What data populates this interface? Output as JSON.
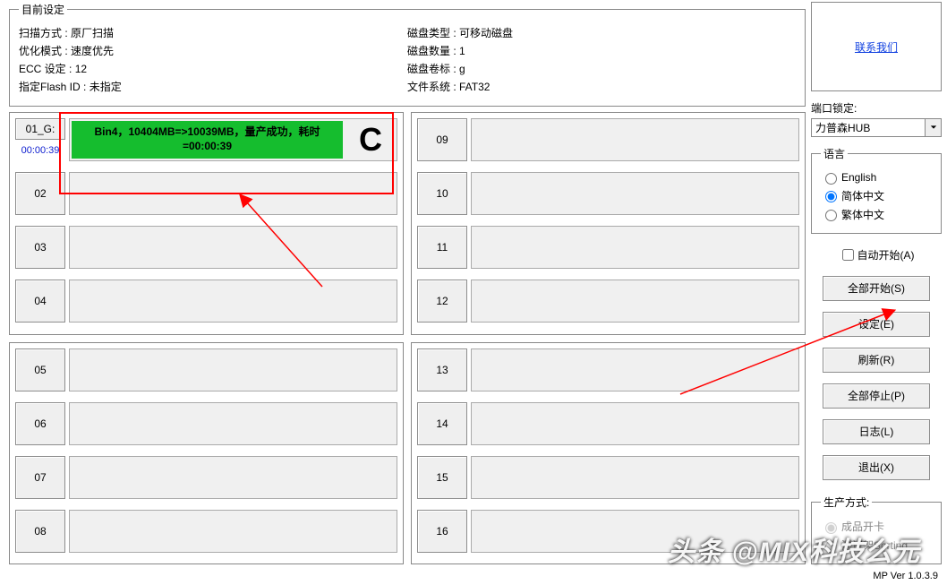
{
  "settings": {
    "legend": "目前设定",
    "left": {
      "scan_mode_label": "扫描方式 : ",
      "scan_mode_value": "原厂扫描",
      "optimize_mode_label": "优化模式 : ",
      "optimize_mode_value": "速度优先",
      "ecc_label": "ECC 设定 : ",
      "ecc_value": "12",
      "flash_id_label": "指定Flash ID : ",
      "flash_id_value": "未指定"
    },
    "right": {
      "disk_type_label": "磁盘类型 : ",
      "disk_type_value": "可移动磁盘",
      "disk_count_label": "磁盘数量 : ",
      "disk_count_value": "1",
      "disk_volume_label": "磁盘卷标 : ",
      "disk_volume_value": "g",
      "filesystem_label": "文件系统 : ",
      "filesystem_value": "FAT32"
    }
  },
  "panels": [
    {
      "slots": [
        {
          "id": "01_G:",
          "time": "00:00:39",
          "success": true,
          "msg": "Bin4，10404MB=>10039MB，量产成功，耗时=00:00:39",
          "status_letter": "C"
        },
        {
          "id": "02"
        },
        {
          "id": "03"
        },
        {
          "id": "04"
        }
      ]
    },
    {
      "slots": [
        {
          "id": "09"
        },
        {
          "id": "10"
        },
        {
          "id": "11"
        },
        {
          "id": "12"
        }
      ]
    },
    {
      "slots": [
        {
          "id": "05"
        },
        {
          "id": "06"
        },
        {
          "id": "07"
        },
        {
          "id": "08"
        }
      ]
    },
    {
      "slots": [
        {
          "id": "13"
        },
        {
          "id": "14"
        },
        {
          "id": "15"
        },
        {
          "id": "16"
        }
      ]
    }
  ],
  "contact_link": "联系我们",
  "port_lock": {
    "label": "端口锁定:",
    "value": "力普森HUB"
  },
  "language": {
    "legend": "语言",
    "options": [
      "English",
      "简体中文",
      "繁体中文"
    ],
    "selected": "简体中文"
  },
  "auto_start": "自动开始(A)",
  "buttons": {
    "start_all": "全部开始(S)",
    "settings": "设定(E)",
    "refresh": "刷新(R)",
    "stop_all": "全部停止(P)",
    "log": "日志(L)",
    "exit": "退出(X)"
  },
  "production": {
    "legend": "生产方式:",
    "options": [
      "成品开卡",
      "测试架Sorting"
    ]
  },
  "version": "MP Ver 1.0.3.9",
  "watermark": "头条 @MIX科技么元"
}
